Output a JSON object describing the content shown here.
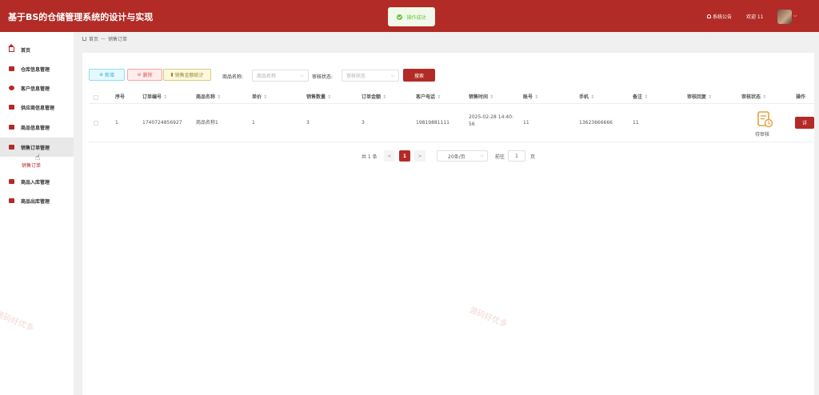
{
  "header": {
    "app_title": "基于BS的仓储管理系统的设计与实现",
    "toast": "操作成功",
    "notice_label": "系统公告",
    "welcome": "欢迎 11"
  },
  "sidebar": {
    "items": [
      {
        "label": "首页",
        "icon": "home-icon"
      },
      {
        "label": "仓库信息管理",
        "icon": "warehouse-icon"
      },
      {
        "label": "客户信息管理",
        "icon": "customer-icon"
      },
      {
        "label": "供应商信息管理",
        "icon": "supplier-icon"
      },
      {
        "label": "商品信息管理",
        "icon": "goods-icon"
      },
      {
        "label": "销售订单管理",
        "icon": "order-icon"
      },
      {
        "label": "商品入库管理",
        "icon": "inbound-icon"
      },
      {
        "label": "商品出库管理",
        "icon": "outbound-icon"
      }
    ],
    "submenu_label": "销售订单"
  },
  "breadcrumb": {
    "home": "首页",
    "separator": "—",
    "current": "销售订单"
  },
  "toolbar": {
    "add_label": "新增",
    "delete_label": "删除",
    "stat_label": "销售金额统计",
    "goods_name_label": "商品名称:",
    "goods_name_placeholder": "商品名称",
    "status_label": "审核状态:",
    "status_placeholder": "审核状态",
    "search_label": "搜索"
  },
  "table": {
    "columns": [
      "序号",
      "订单编号",
      "商品名称",
      "单价",
      "销售数量",
      "订单金额",
      "客户电话",
      "销售时间",
      "账号",
      "手机",
      "备注",
      "审核回复",
      "审核状态",
      "操作"
    ],
    "rows": [
      {
        "index": "1",
        "order_no": "1740724856927",
        "goods_name": "商品名称1",
        "price": "1",
        "quantity": "3",
        "amount": "3",
        "phone": "19819881111",
        "time_line1": "2025-02-28 14:40:",
        "time_line2": "56",
        "account": "11",
        "mobile": "13623666666",
        "remark": "11",
        "reply": "",
        "status": "待审核",
        "action_label": "详"
      }
    ]
  },
  "pagination": {
    "total": "共 1 条",
    "prev": "<",
    "current": "1",
    "next": ">",
    "page_size": "20条/页",
    "goto_label": "前往",
    "goto_value": "1",
    "page_unit": "页"
  },
  "watermark": "源码好优多",
  "colors": {
    "brand": "#b22b26",
    "success": "#67c23a",
    "status_icon": "#e6a23c"
  }
}
